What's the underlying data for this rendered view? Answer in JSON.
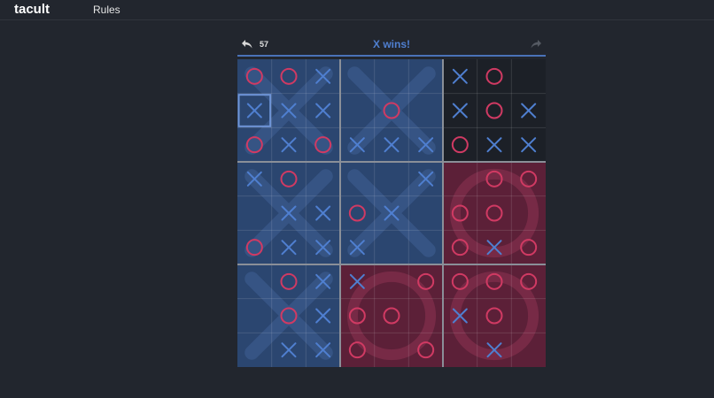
{
  "app": {
    "title": "tacult"
  },
  "nav": {
    "rules_label": "Rules"
  },
  "status": {
    "move_count": "57",
    "message": "X wins!",
    "undo_icon": "undo-arrow-icon",
    "redo_icon": "redo-arrow-icon"
  },
  "colors": {
    "page_bg": "#22262e",
    "x_color": "#4f7fd0",
    "o_color": "#d03a63",
    "x_won_bg": "#2b4670",
    "o_won_bg": "#5c2038",
    "open_bg": "#1c2027",
    "status_color": "#4f7fd0"
  },
  "board": {
    "last_move": {
      "board": 0,
      "cell": 3
    },
    "small_boards": [
      {
        "winner": "X",
        "cells": [
          "O",
          "O",
          "X",
          "X",
          "X",
          "X",
          "O",
          "X",
          "O"
        ]
      },
      {
        "winner": "X",
        "cells": [
          "",
          "",
          "",
          "",
          "O",
          "",
          "X",
          "X",
          "X"
        ]
      },
      {
        "winner": "",
        "cells": [
          "X",
          "O",
          "",
          "X",
          "O",
          "X",
          "O",
          "X",
          "X"
        ]
      },
      {
        "winner": "X",
        "cells": [
          "X",
          "O",
          "",
          "",
          "X",
          "X",
          "O",
          "X",
          "X"
        ]
      },
      {
        "winner": "X",
        "cells": [
          "",
          "",
          "X",
          "O",
          "X",
          "",
          "X",
          "",
          ""
        ]
      },
      {
        "winner": "O",
        "cells": [
          "",
          "O",
          "O",
          "O",
          "O",
          "",
          "O",
          "X",
          "O"
        ]
      },
      {
        "winner": "X",
        "cells": [
          "",
          "O",
          "X",
          "",
          "O",
          "X",
          "",
          "X",
          "X"
        ]
      },
      {
        "winner": "O",
        "cells": [
          "X",
          "",
          "O",
          "O",
          "O",
          "",
          "O",
          "",
          "O"
        ]
      },
      {
        "winner": "O",
        "cells": [
          "O",
          "O",
          "O",
          "X",
          "O",
          "",
          "",
          "X",
          ""
        ]
      }
    ]
  }
}
